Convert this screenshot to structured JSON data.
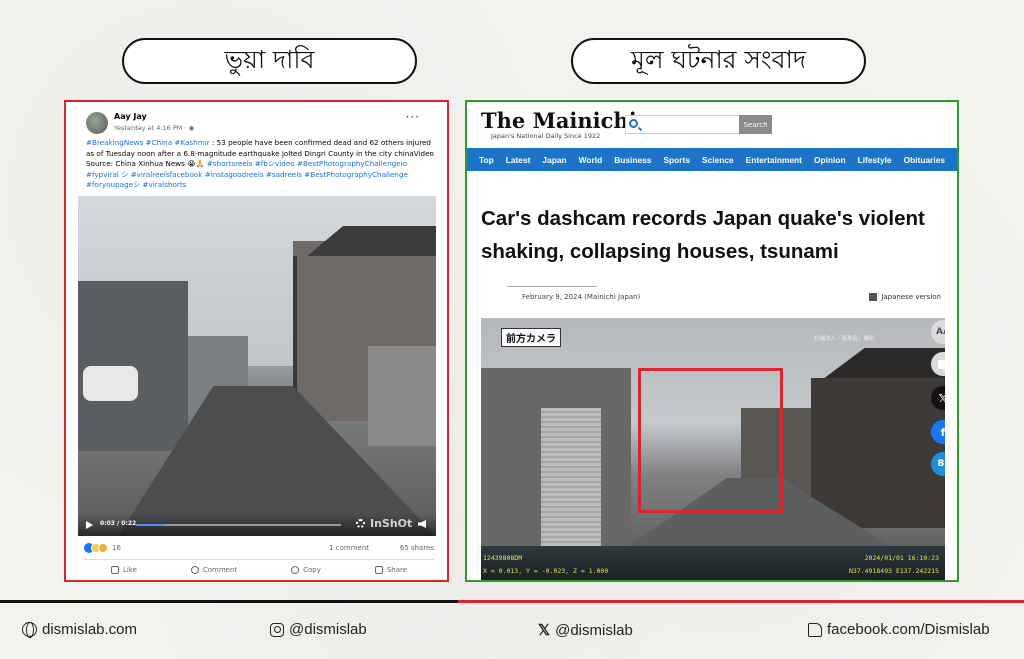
{
  "labels": {
    "claim": "ভুয়া দাবি",
    "source": "মূল ঘটনার সংবাদ"
  },
  "facebook_post": {
    "author": "Aay Jay",
    "time": "Yesterday at 4:16 PM · ◉",
    "menu": "···",
    "text_hashtags_1": "#BreakingNews #China #Kashmir",
    "text_body": " : 53 people have been confirmed dead and 62 others injured as of Tuesday noon after a 6.8-magnitude earthquake jolted Dingri County in the city chinaVideo Source: China Xinhua News 😭🙏 ",
    "text_hashtags_2": "#shortsreels #fbシvideo #BestPhotographyChallengeio #fypviral シ #viralreelsfacebook #instagoodreels #sadreels #BestPhotographyChallenge #foryoupageシ #viralshorts",
    "video_time": "0:03 / 0:22",
    "video_progress": 0.14,
    "watermark": "InShOt",
    "reaction_count": "16",
    "comments": "1 comment",
    "shares": "65 shares",
    "actions": [
      "Like",
      "Comment",
      "Copy",
      "Share"
    ]
  },
  "mainichi": {
    "logo": "The Mainichi",
    "tagline": "Japan's National Daily Since 1922",
    "search_placeholder": "",
    "search_button": "Search",
    "nav": [
      "Top",
      "Latest",
      "Japan",
      "World",
      "Business",
      "Sports",
      "Science",
      "Entertainment",
      "Opinion",
      "Lifestyle",
      "Obituaries"
    ],
    "title": "Car's dashcam records Japan quake's violent shaking, collapsing houses, tsunami",
    "date": "February 9, 2024 (Mainichi Japan)",
    "japanese_version": "Japanese version",
    "image": {
      "cam_label": "前方カメラ",
      "top_right_caption": "社福法人「長寿会」撮影",
      "footer_left_1": "12439808DM",
      "footer_left_2": "X = 0.013, Y = -0.023, Z = 1.000",
      "footer_right_1": "2024/01/01 16:10:23",
      "footer_right_2": "N37.4918493 E137.242215"
    },
    "share_buttons": [
      "AA",
      "print",
      "𝕏",
      "f",
      "B!"
    ]
  },
  "footer": {
    "website": "dismislab.com",
    "instagram": "@dismislab",
    "x": "@dismislab",
    "facebook": "facebook.com/Dismislab"
  },
  "colors": {
    "claim_border": "#d8262e",
    "source_border": "#2f9a32",
    "mainichi_nav": "#1c74c8"
  }
}
